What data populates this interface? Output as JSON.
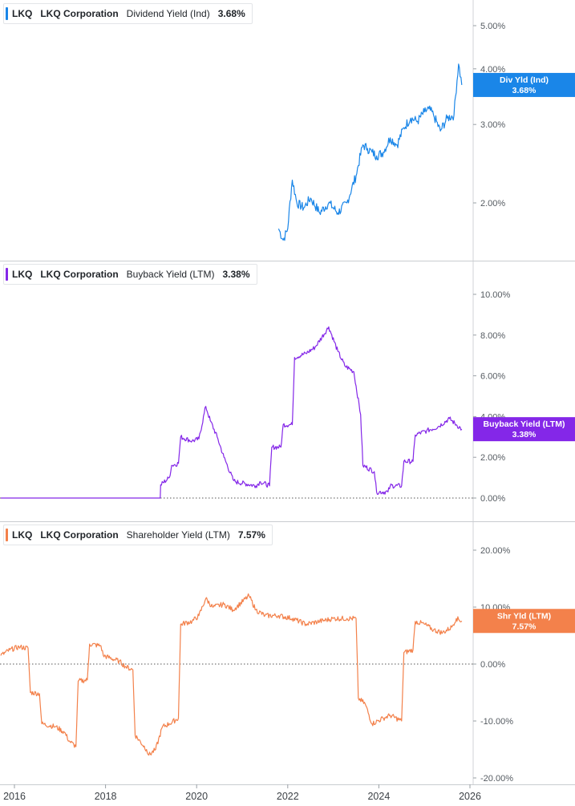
{
  "chart_data": {
    "type": "line",
    "x_axis": {
      "ticks": [
        "2016",
        "2018",
        "2020",
        "2022",
        "2024",
        "2026"
      ]
    },
    "panels": [
      {
        "ticker": "LKQ",
        "company": "LKQ Corporation",
        "metric": "Dividend Yield (Ind)",
        "value": "3.68%",
        "color": "#1a86e8",
        "scale": "log",
        "y_ticks": [
          "2.00%",
          "3.00%",
          "4.00%",
          "5.00%"
        ],
        "badge": {
          "label": "Div Yld (Ind)",
          "value": "3.68%"
        },
        "series": {
          "name": "Dividend Yield (Ind)",
          "x": [
            2021.8,
            2021.9,
            2022.0,
            2022.1,
            2022.2,
            2022.35,
            2022.5,
            2022.7,
            2022.9,
            2023.1,
            2023.3,
            2023.5,
            2023.65,
            2023.75,
            2023.85,
            2023.95,
            2024.1,
            2024.25,
            2024.4,
            2024.55,
            2024.7,
            2024.85,
            2025.0,
            2025.1,
            2025.2,
            2025.35,
            2025.5,
            2025.65,
            2025.75,
            2025.82
          ],
          "y": [
            1.75,
            1.65,
            1.75,
            2.25,
            2.0,
            1.95,
            2.05,
            1.9,
            2.0,
            1.9,
            2.0,
            2.3,
            2.7,
            2.65,
            2.6,
            2.55,
            2.6,
            2.8,
            2.7,
            2.95,
            3.1,
            3.05,
            3.2,
            3.25,
            3.15,
            2.9,
            3.1,
            3.15,
            4.1,
            3.68
          ]
        }
      },
      {
        "ticker": "LKQ",
        "company": "LKQ Corporation",
        "metric": "Buyback Yield (LTM)",
        "value": "3.38%",
        "color": "#8427e8",
        "scale": "linear",
        "y_ticks": [
          "0.00%",
          "2.00%",
          "4.00%",
          "6.00%",
          "8.00%",
          "10.00%"
        ],
        "badge": {
          "label": "Buyback Yield (LTM)",
          "value": "3.38%"
        },
        "series": {
          "name": "Buyback Yield (LTM)",
          "x": [
            2015.7,
            2019.2,
            2019.21,
            2019.4,
            2019.45,
            2019.6,
            2019.65,
            2019.9,
            2020.05,
            2020.2,
            2020.3,
            2020.45,
            2020.6,
            2020.8,
            2020.85,
            2021.3,
            2021.4,
            2021.6,
            2021.65,
            2021.85,
            2021.9,
            2022.1,
            2022.15,
            2022.4,
            2022.6,
            2022.9,
            2023.1,
            2023.25,
            2023.45,
            2023.6,
            2023.65,
            2023.9,
            2023.95,
            2024.2,
            2024.25,
            2024.5,
            2024.55,
            2024.75,
            2024.8,
            2025.05,
            2025.3,
            2025.55,
            2025.7,
            2025.82
          ],
          "y": [
            0.0,
            0.0,
            0.65,
            1.0,
            1.6,
            1.7,
            3.0,
            2.8,
            2.9,
            4.5,
            3.8,
            3.0,
            2.0,
            0.9,
            0.8,
            0.6,
            0.8,
            0.6,
            2.5,
            2.5,
            3.6,
            3.6,
            6.9,
            7.1,
            7.4,
            8.4,
            7.2,
            6.5,
            6.2,
            4.1,
            1.6,
            1.3,
            0.3,
            0.3,
            0.6,
            0.6,
            1.8,
            1.8,
            3.1,
            3.3,
            3.5,
            3.9,
            3.6,
            3.38
          ]
        }
      },
      {
        "ticker": "LKQ",
        "company": "LKQ Corporation",
        "metric": "Shareholder Yield (LTM)",
        "value": "7.57%",
        "color": "#f3814b",
        "scale": "linear",
        "y_ticks": [
          "-20.00%",
          "-10.00%",
          "0.00%",
          "10.00%",
          "20.00%"
        ],
        "badge": {
          "label": "Shr Yld (LTM)",
          "value": "7.57%"
        },
        "series": {
          "name": "Shareholder Yield (LTM)",
          "x": [
            2015.7,
            2015.9,
            2016.1,
            2016.3,
            2016.35,
            2016.55,
            2016.6,
            2016.9,
            2017.1,
            2017.2,
            2017.35,
            2017.4,
            2017.6,
            2017.65,
            2017.9,
            2017.95,
            2018.3,
            2018.45,
            2018.6,
            2018.65,
            2018.9,
            2018.95,
            2019.1,
            2019.25,
            2019.4,
            2019.6,
            2019.65,
            2019.9,
            2020.05,
            2020.2,
            2020.35,
            2020.6,
            2020.8,
            2021.15,
            2021.3,
            2021.5,
            2021.8,
            2022.1,
            2022.4,
            2022.7,
            2023.0,
            2023.3,
            2023.5,
            2023.55,
            2023.7,
            2023.85,
            2024.1,
            2024.25,
            2024.5,
            2024.55,
            2024.75,
            2024.8,
            2025.0,
            2025.2,
            2025.4,
            2025.6,
            2025.7,
            2025.82
          ],
          "y": [
            1.5,
            2.5,
            3.0,
            2.8,
            -5.0,
            -5.2,
            -10.5,
            -11.0,
            -12.0,
            -13.5,
            -14.5,
            -3.0,
            -2.8,
            3.5,
            3.2,
            1.5,
            0.5,
            -0.5,
            -1.0,
            -12.5,
            -15.0,
            -16.0,
            -15.0,
            -11.0,
            -10.5,
            -9.5,
            7.0,
            7.5,
            8.5,
            11.5,
            10.0,
            10.5,
            9.5,
            12.0,
            9.5,
            8.5,
            8.5,
            8.0,
            7.0,
            7.5,
            8.0,
            8.0,
            8.0,
            -6.0,
            -7.0,
            -10.5,
            -9.5,
            -9.0,
            -10.0,
            2.0,
            2.5,
            7.5,
            7.0,
            6.0,
            5.5,
            6.5,
            8.0,
            7.57
          ]
        }
      }
    ]
  }
}
